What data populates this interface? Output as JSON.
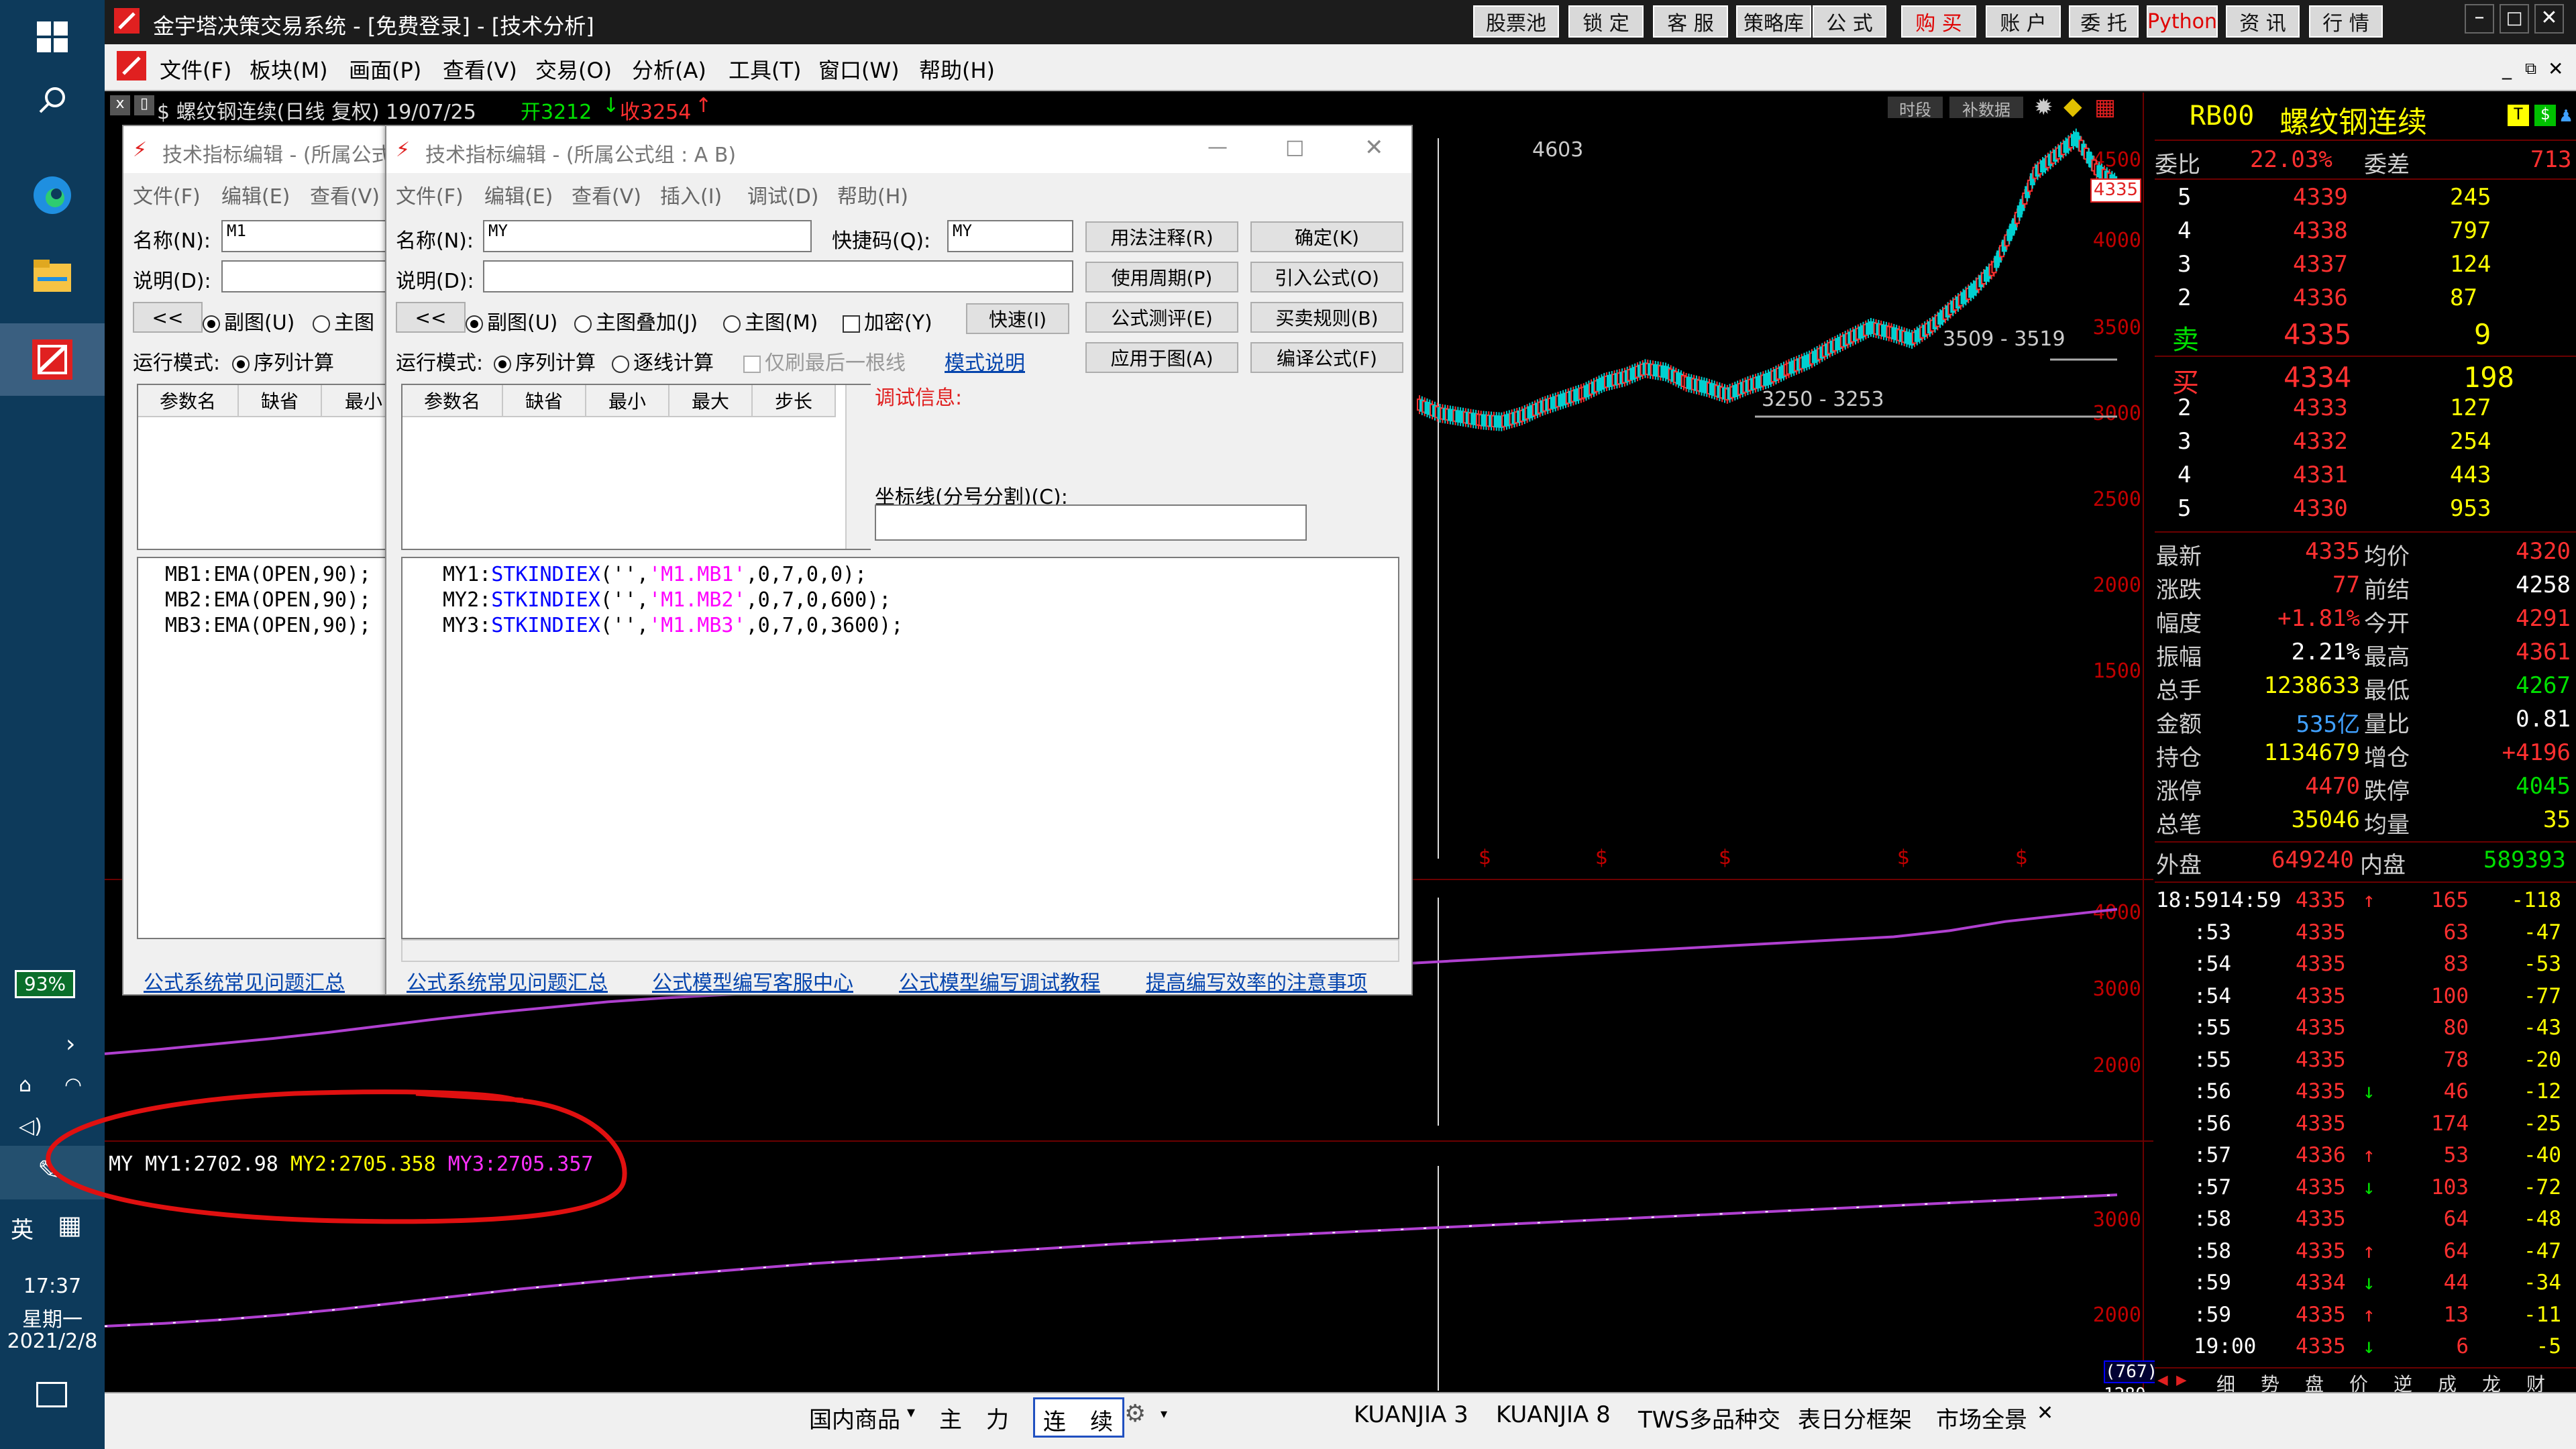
{
  "taskbar": {
    "battery": "93%",
    "ime": "英",
    "time": "17:37",
    "weekday": "星期一",
    "date": "2021/2/8"
  },
  "titlebar": {
    "title": "金宇塔决策交易系统 - [免费登录] - [技术分析]",
    "buttons": [
      "股票池",
      "锁 定",
      "客 服",
      "策略库",
      "公 式",
      "购 买",
      "账 户",
      "委 托",
      "Python",
      "资 讯",
      "行 情"
    ]
  },
  "menu": [
    "文件(F)",
    "板块(M)",
    "画面(P)",
    "查看(V)",
    "交易(O)",
    "分析(A)",
    "工具(T)",
    "窗口(W)",
    "帮助(H)"
  ],
  "chart": {
    "header": "$ 螺纹钢连续(日线 复权) 19/07/25",
    "open_label": "开3212",
    "close_label": "收3254",
    "btn_time": "时段",
    "btn_fill": "补数据",
    "label_high": "4603",
    "label_r1": "3509 - 3519",
    "label_r2": "3250 - 3253",
    "price_tag": "4335",
    "main_axis": [
      "4500",
      "4000",
      "3500",
      "3000",
      "2500",
      "2000",
      "1500"
    ],
    "mid_axis": [
      "4000",
      "3000",
      "2000"
    ],
    "low_axis": [
      "3000",
      "2000"
    ],
    "mid_range": [
      1700,
      4200
    ],
    "low_range": [
      1800,
      3400
    ],
    "low_legend": {
      "name": "MY",
      "my1": "MY1:2702.98",
      "my2": "MY2:2705.358",
      "my3": "MY3:2705.357"
    },
    "axis_bottom": [
      "(767)",
      "1280"
    ],
    "dollar_marks": [
      "$",
      "$",
      "$",
      "$",
      "$"
    ],
    "main_series": [
      3050,
      3000,
      2980,
      2960,
      2950,
      2985,
      3040,
      3080,
      3120,
      3180,
      3210,
      3260,
      3240,
      3180,
      3150,
      3110,
      3160,
      3200,
      3260,
      3310,
      3380,
      3440,
      3500,
      3470,
      3430,
      3510,
      3620,
      3720,
      3850,
      4100,
      4400,
      4500,
      4603,
      4420,
      4335
    ],
    "mid_series": [
      2150,
      2210,
      2280,
      2350,
      2430,
      2520,
      2610,
      2690,
      2760,
      2830,
      2880,
      2920,
      2955,
      2990,
      3020,
      3050,
      3080,
      3110,
      3140,
      3170,
      3200,
      3240,
      3280,
      3320,
      3360,
      3400,
      3440,
      3480,
      3520,
      3560,
      3600,
      3640,
      3680,
      3760,
      3880,
      3960,
      4040
    ],
    "low_series": [
      1880,
      1910,
      1950,
      2000,
      2060,
      2130,
      2200,
      2270,
      2330,
      2390,
      2440,
      2490,
      2540,
      2580,
      2620,
      2660,
      2700,
      2740,
      2775,
      2810,
      2840,
      2870,
      2900,
      2930,
      2960,
      2990,
      3020,
      3050,
      3080,
      3110,
      3140,
      3170,
      3200,
      3230,
      3260
    ]
  },
  "quote": {
    "code": "RB00",
    "name": "螺纹钢连续",
    "ratio_label": "委比",
    "ratio": "22.03%",
    "diff_label": "委差",
    "diff": "713",
    "asks": [
      [
        "5",
        "4339",
        "245"
      ],
      [
        "4",
        "4338",
        "797"
      ],
      [
        "3",
        "4337",
        "124"
      ],
      [
        "2",
        "4336",
        "87"
      ],
      [
        "卖",
        "4335",
        "9"
      ]
    ],
    "bids": [
      [
        "买",
        "4334",
        "198"
      ],
      [
        "2",
        "4333",
        "127"
      ],
      [
        "3",
        "4332",
        "254"
      ],
      [
        "4",
        "4331",
        "443"
      ],
      [
        "5",
        "4330",
        "953"
      ]
    ],
    "stats": [
      [
        "最新",
        "4335",
        "均价",
        "4320"
      ],
      [
        "涨跌",
        "77",
        "前结",
        "4258"
      ],
      [
        "幅度",
        "+1.81%",
        "今开",
        "4291"
      ],
      [
        "振幅",
        "2.21%",
        "最高",
        "4361"
      ],
      [
        "总手",
        "1238633",
        "最低",
        "4267"
      ],
      [
        "金额",
        "535亿",
        "量比",
        "0.81"
      ],
      [
        "持仓",
        "1134679",
        "增仓",
        "+4196"
      ],
      [
        "涨停",
        "4470",
        "跌停",
        "4045"
      ],
      [
        "总笔",
        "35046",
        "均量",
        "35"
      ]
    ],
    "outer_label": "外盘",
    "outer": "649240",
    "inner_label": "内盘",
    "inner": "589393",
    "ticks": [
      [
        "18:5914:59",
        "4335",
        "↑",
        "165",
        "-118"
      ],
      [
        ":53",
        "4335",
        "",
        "63",
        "-47"
      ],
      [
        ":54",
        "4335",
        "",
        "83",
        "-53"
      ],
      [
        ":54",
        "4335",
        "",
        "100",
        "-77"
      ],
      [
        ":55",
        "4335",
        "",
        "80",
        "-43"
      ],
      [
        ":55",
        "4335",
        "",
        "78",
        "-20"
      ],
      [
        ":56",
        "4335",
        "↓",
        "46",
        "-12"
      ],
      [
        ":56",
        "4335",
        "",
        "174",
        "-25"
      ],
      [
        ":57",
        "4336",
        "↑",
        "53",
        "-40"
      ],
      [
        ":57",
        "4335",
        "↓",
        "103",
        "-72"
      ],
      [
        ":58",
        "4335",
        "",
        "64",
        "-48"
      ],
      [
        ":58",
        "4335",
        "↑",
        "64",
        "-47"
      ],
      [
        ":59",
        "4334",
        "↓",
        "44",
        "-34"
      ],
      [
        ":59",
        "4335",
        "↑",
        "13",
        "-11"
      ],
      [
        "19:00",
        "4335",
        "↓",
        "6",
        "-5"
      ]
    ],
    "bottom_tabs": [
      "细",
      "势",
      "盘",
      "价",
      "逆",
      "成",
      "龙",
      "财"
    ]
  },
  "bottombar": {
    "tabs": [
      "国内商品",
      "主",
      "力",
      "连",
      "续",
      "KUANJIA 3",
      "KUANJIA 8",
      "TWS多品种交",
      "表日分框架",
      "市场全景"
    ]
  },
  "dialog1": {
    "title": "技术指标编辑 - (所属公式",
    "menu": [
      "文件(F)",
      "编辑(E)",
      "查看(V)"
    ],
    "name_label": "名称(N):",
    "name_value": "M1",
    "desc_label": "说明(D):",
    "radio_sub": "副图(U)",
    "radio_main": "主图",
    "mode_label": "运行模式:",
    "mode_seq": "序列计算",
    "grid_headers": [
      "参数名",
      "缺省",
      "最小"
    ],
    "code": [
      "MB1:EMA(OPEN,90);",
      "MB2:EMA(OPEN,90);",
      "MB3:EMA(OPEN,90);"
    ],
    "link": "公式系统常见问题汇总"
  },
  "dialog2": {
    "title": "技术指标编辑 - (所属公式组 : A B)",
    "menu": [
      "文件(F)",
      "编辑(E)",
      "查看(V)",
      "插入(I)",
      "调试(D)",
      "帮助(H)"
    ],
    "name_label": "名称(N):",
    "name_value": "MY",
    "hotkey_label": "快捷码(Q):",
    "hotkey_value": "MY",
    "desc_label": "说明(D):",
    "radio_sub": "副图(U)",
    "radio_overlay": "主图叠加(J)",
    "radio_main": "主图(M)",
    "chk_encrypt": "加密(Y)",
    "btn_fast": "快速(I)",
    "mode_label": "运行模式:",
    "mode_seq": "序列计算",
    "mode_each": "逐线计算",
    "chk_last": "仅刷最后一根线",
    "mode_link": "模式说明",
    "debug_label": "调试信息:",
    "axis_label": "坐标线(分号分割)(C):",
    "grid_headers": [
      "参数名",
      "缺省",
      "最小",
      "最大",
      "步长"
    ],
    "buttons": [
      "用法注释(R)",
      "确定(K)",
      "使用周期(P)",
      "引入公式(O)",
      "公式测评(E)",
      "买卖规则(B)",
      "应用于图(A)",
      "编译公式(F)"
    ],
    "code": [
      [
        "MY1:",
        "STKINDIEX",
        "(''",
        ",",
        "'M1.MB1'",
        ",0,7,0,0);"
      ],
      [
        "MY2:",
        "STKINDIEX",
        "(''",
        ",",
        "'M1.MB2'",
        ",0,7,0,600);"
      ],
      [
        "MY3:",
        "STKINDIEX",
        "(''",
        ",",
        "'M1.MB3'",
        ",0,7,0,3600);"
      ]
    ],
    "links": [
      "公式系统常见问题汇总",
      "公式模型编写客服中心",
      "公式模型编写调试教程",
      "提高编写效率的注意事项"
    ]
  }
}
